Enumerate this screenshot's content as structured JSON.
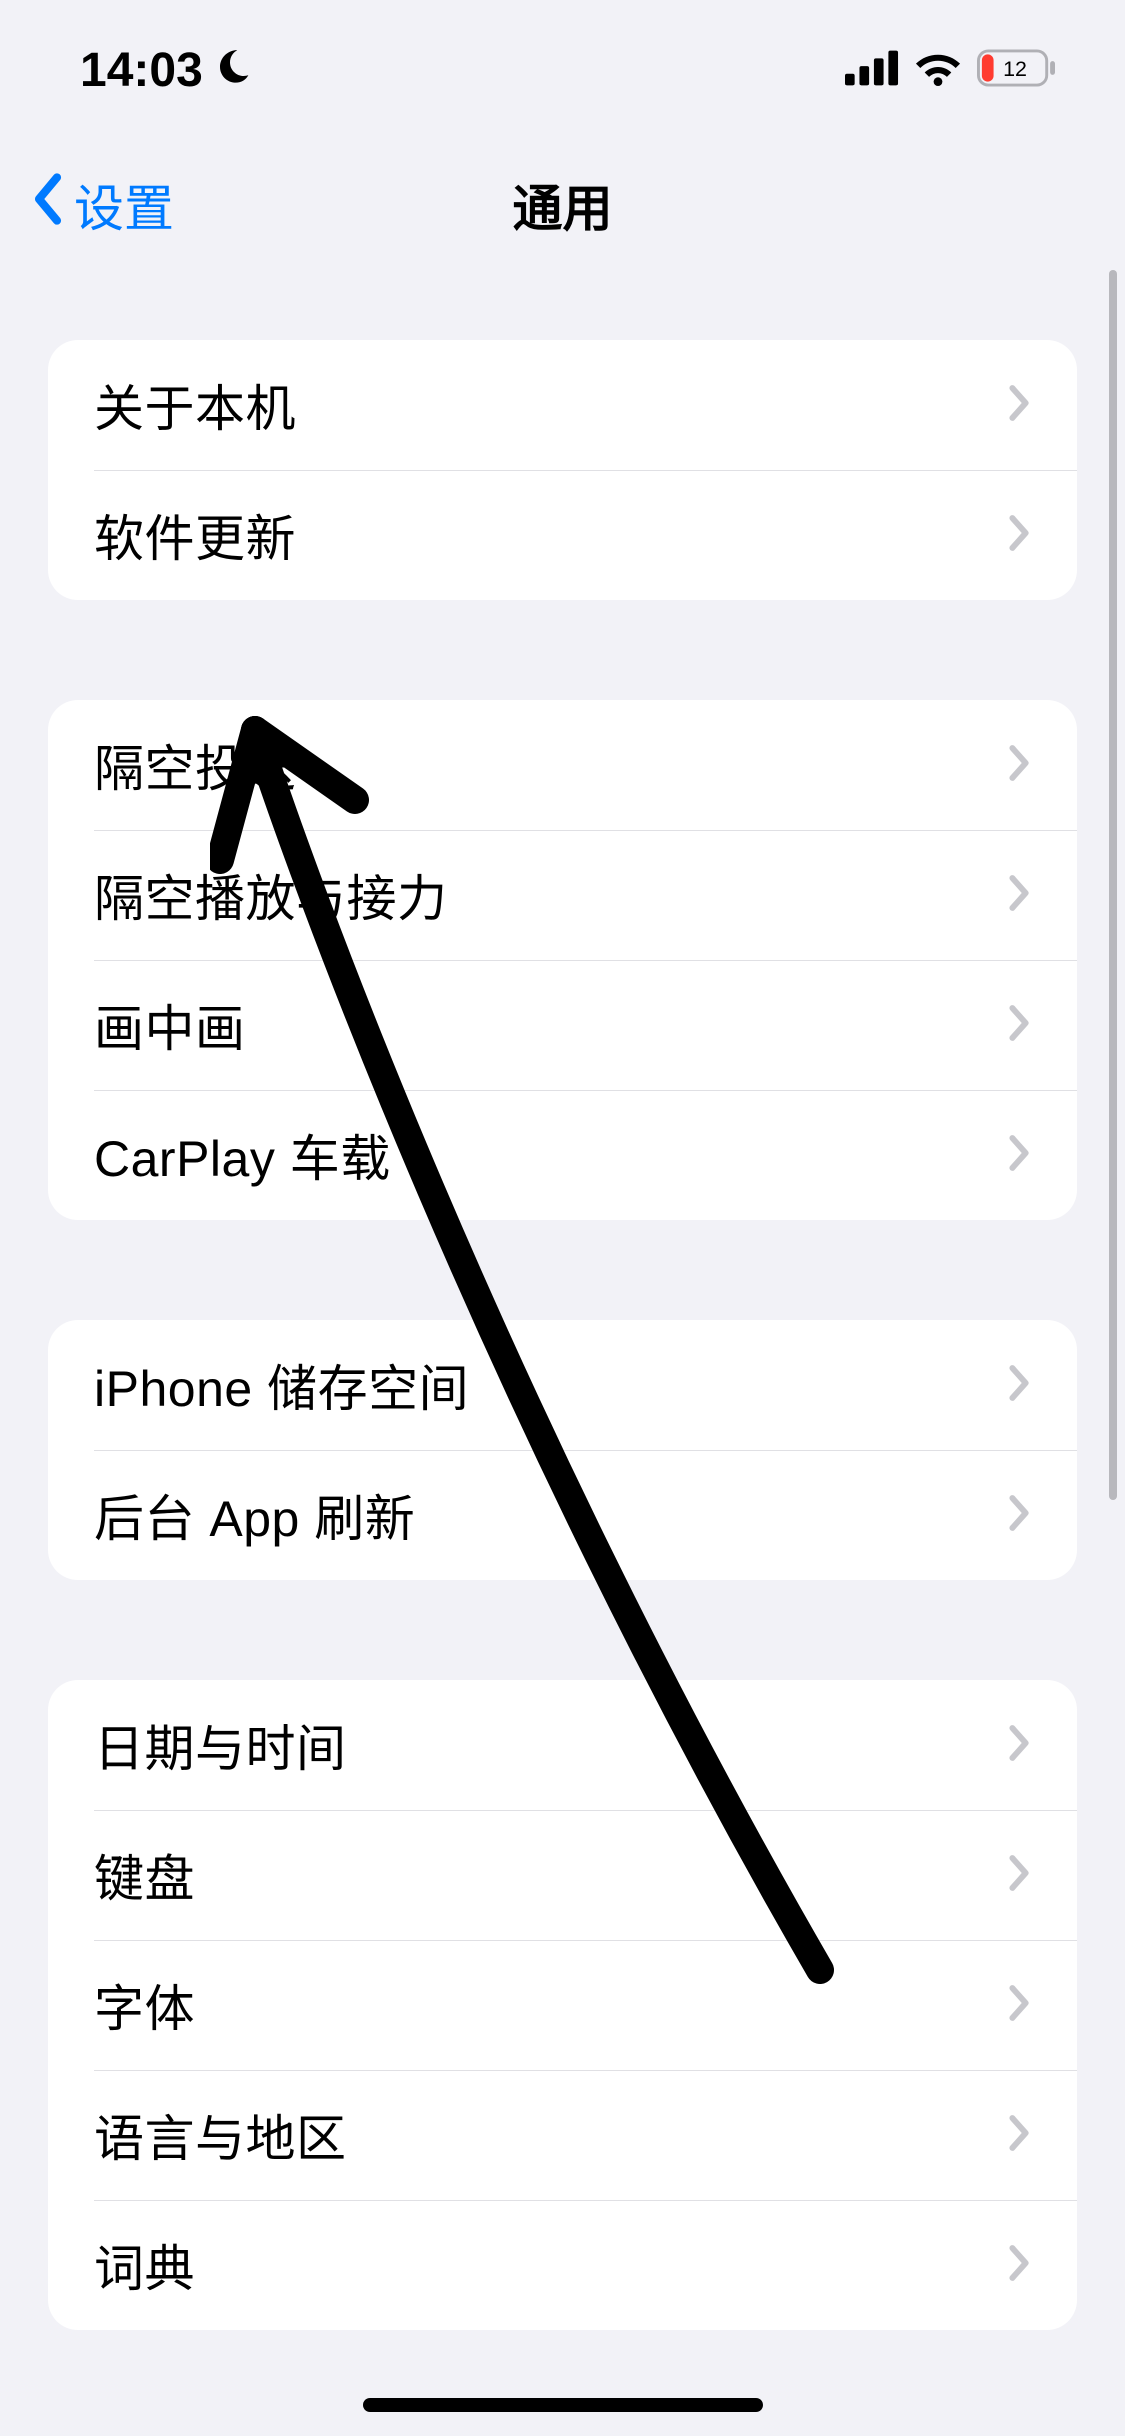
{
  "status": {
    "time": "14:03",
    "battery_percent": "12"
  },
  "nav": {
    "back_label": "设置",
    "title": "通用"
  },
  "groups": [
    {
      "id": "group-about",
      "items": [
        {
          "id": "row-about",
          "label": "关于本机"
        },
        {
          "id": "row-software-update",
          "label": "软件更新"
        }
      ]
    },
    {
      "id": "group-connectivity",
      "items": [
        {
          "id": "row-airdrop",
          "label": "隔空投送"
        },
        {
          "id": "row-airplay-handoff",
          "label": "隔空播放与接力"
        },
        {
          "id": "row-pip",
          "label": "画中画"
        },
        {
          "id": "row-carplay",
          "label": "CarPlay 车载"
        }
      ]
    },
    {
      "id": "group-storage",
      "items": [
        {
          "id": "row-iphone-storage",
          "label": "iPhone 储存空间"
        },
        {
          "id": "row-background-refresh",
          "label": "后台 App 刷新"
        }
      ]
    },
    {
      "id": "group-locale",
      "items": [
        {
          "id": "row-date-time",
          "label": "日期与时间"
        },
        {
          "id": "row-keyboard",
          "label": "键盘"
        },
        {
          "id": "row-fonts",
          "label": "字体"
        },
        {
          "id": "row-language-region",
          "label": "语言与地区"
        },
        {
          "id": "row-dictionary",
          "label": "词典"
        }
      ]
    }
  ]
}
